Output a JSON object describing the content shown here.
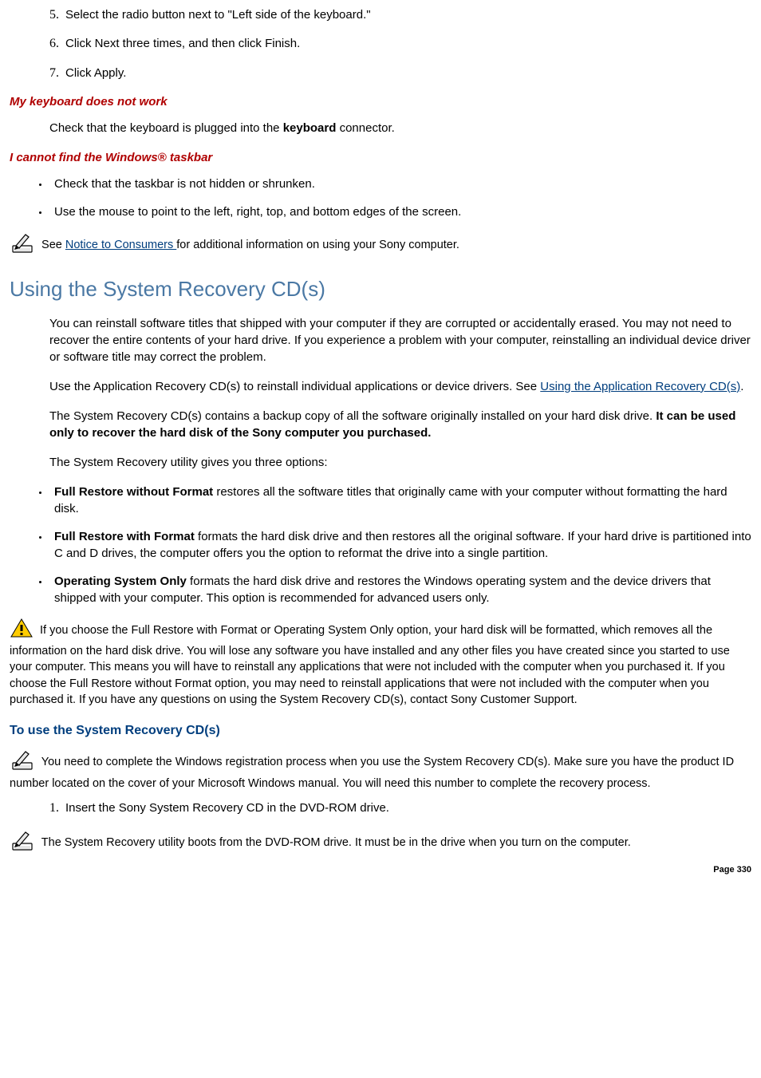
{
  "top_list": {
    "item5": "Select the radio button next to \"Left side of the keyboard.\"",
    "item6": "Click Next three times, and then click Finish.",
    "item7": "Click Apply."
  },
  "kb_section": {
    "heading": "My keyboard does not work",
    "text_pre": "Check that the keyboard is plugged into the ",
    "text_bold": "keyboard",
    "text_post": " connector."
  },
  "taskbar_section": {
    "heading": "I cannot find the Windows® taskbar",
    "bullet1": "Check that the taskbar is not hidden or shrunken.",
    "bullet2": "Use the mouse to point to the left, right, top, and bottom edges of the screen."
  },
  "notice_note": {
    "pre": " See ",
    "link": "Notice to Consumers ",
    "post": "for additional information on using your Sony computer."
  },
  "recovery": {
    "title": "Using the System Recovery CD(s)",
    "p1": "You can reinstall software titles that shipped with your computer if they are corrupted or accidentally erased. You may not need to recover the entire contents of your hard drive. If you experience a problem with your computer, reinstalling an individual device driver or software title may correct the problem.",
    "p2_pre": "Use the Application Recovery CD(s) to reinstall individual applications or device drivers. See ",
    "p2_link": "Using the Application Recovery CD(s)",
    "p2_post": ".",
    "p3_pre": "The System Recovery CD(s) contains a backup copy of all the software originally installed on your hard disk drive. ",
    "p3_bold": "It can be used only to recover the hard disk of the Sony computer you purchased.",
    "p4": "The System Recovery utility gives you three options:",
    "opts": {
      "o1_b": "Full Restore without Format",
      "o1_t": " restores all the software titles that originally came with your computer without formatting the hard disk.",
      "o2_b": "Full Restore with Format",
      "o2_t": " formats the hard disk drive and then restores all the original software. If your hard drive is partitioned into C and D drives, the computer offers you the option to reformat the drive into a single partition.",
      "o3_b": "Operating System Only",
      "o3_t": " formats the hard disk drive and restores the Windows operating system and the device drivers that shipped with your computer. This option is recommended for advanced users only."
    },
    "warning": " If you choose the Full Restore with Format or Operating System Only option, your hard disk will be formatted, which removes all the information on the hard disk drive. You will lose any software you have installed and any other files you have created since you started to use your computer. This means you will have to reinstall any applications that were not included with the computer when you purchased it. If you choose the Full Restore without Format option, you may need to reinstall applications that were not included with the computer when you purchased it. If you have any questions on using the System Recovery CD(s), contact Sony Customer Support."
  },
  "use_recovery": {
    "heading": "To use the System Recovery CD(s)",
    "note1": " You need to complete the Windows registration process when you use the System Recovery CD(s). Make sure you have the product ID number located on the cover of your Microsoft Windows manual. You will need this number to complete the recovery process.",
    "step1": "Insert the Sony System Recovery CD in the DVD-ROM drive.",
    "note2": " The System Recovery utility boots from the DVD-ROM drive. It must be in the drive when you turn on the computer."
  },
  "page_number": "Page 330"
}
